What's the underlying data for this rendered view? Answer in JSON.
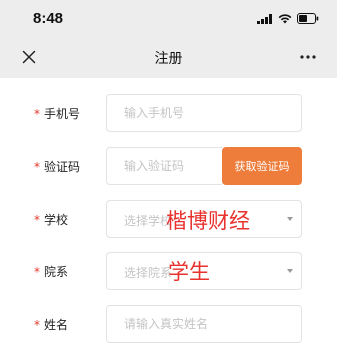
{
  "status_bar": {
    "time": "8:48"
  },
  "nav": {
    "title": "注册",
    "more": "···"
  },
  "form": {
    "phone": {
      "label": "手机号",
      "placeholder": "输入手机号"
    },
    "code": {
      "label": "验证码",
      "placeholder": "输入验证码",
      "button": "获取验证码"
    },
    "school": {
      "label": "学校",
      "placeholder": "选择学校"
    },
    "department": {
      "label": "院系",
      "placeholder": "选择院系"
    },
    "name": {
      "label": "姓名",
      "placeholder": "请输入真实姓名"
    },
    "required_mark": "*"
  },
  "overlay": {
    "line1": "楷博财经",
    "line2": "学生"
  },
  "colors": {
    "accent": "#ee7c3a",
    "required": "#e23b2e",
    "overlay_text": "#e8322e",
    "header_bg": "#ededed"
  }
}
